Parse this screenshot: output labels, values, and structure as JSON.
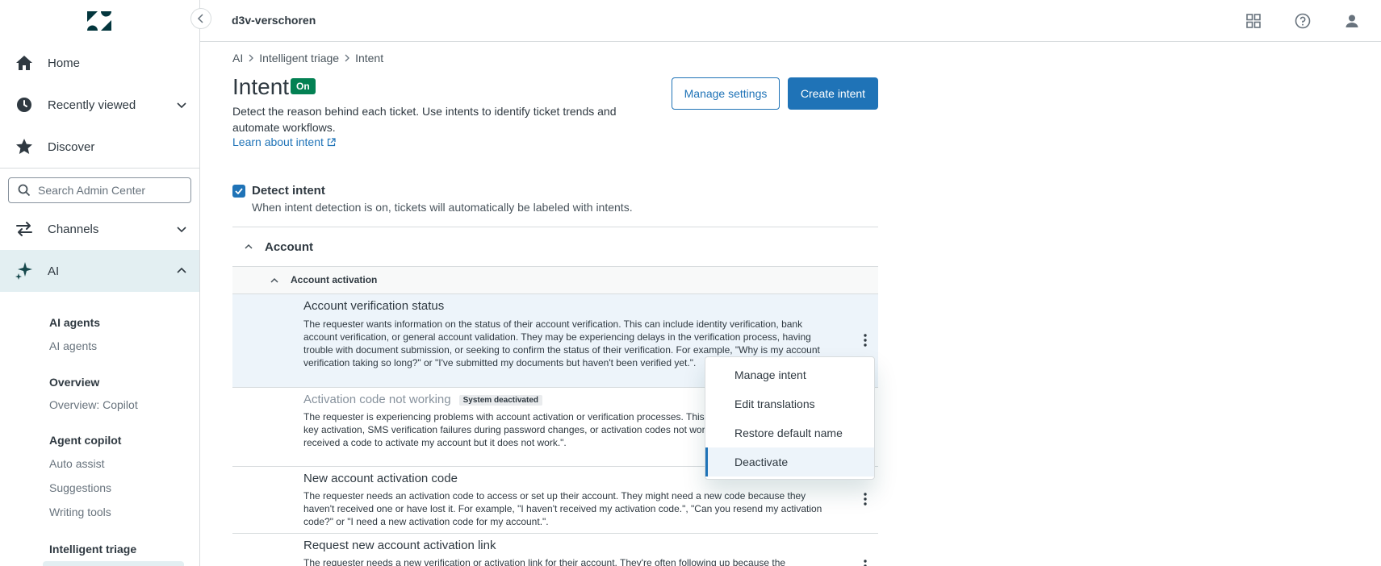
{
  "sidebar": {
    "collapse_label": "Collapse sidebar",
    "nav_top": [
      {
        "label": "Home",
        "icon": "home-icon"
      },
      {
        "label": "Recently viewed",
        "icon": "clock-icon"
      },
      {
        "label": "Discover",
        "icon": "star-icon"
      }
    ],
    "search_placeholder": "Search Admin Center",
    "nav_main": [
      {
        "label": "Channels",
        "icon": "arrows-swap-icon"
      },
      {
        "label": "AI",
        "icon": "sparkle-icon",
        "active": true
      }
    ],
    "sections": [
      {
        "heading": "AI agents",
        "links": [
          "AI agents"
        ]
      },
      {
        "heading": "Overview",
        "links": [
          "Overview: Copilot"
        ]
      },
      {
        "heading": "Agent copilot",
        "links": [
          "Auto assist",
          "Suggestions",
          "Writing tools"
        ]
      },
      {
        "heading": "Intelligent triage",
        "links": []
      }
    ]
  },
  "header": {
    "account": "d3v-verschoren",
    "icons": [
      "products-grid-icon",
      "help-icon",
      "user-icon"
    ]
  },
  "breadcrumb": [
    "AI",
    "Intelligent triage",
    "Intent"
  ],
  "page": {
    "title": "Intent",
    "status_badge": "On",
    "description": "Detect the reason behind each ticket. Use intents to identify ticket trends and automate workflows.",
    "learn_link": "Learn about intent",
    "manage_settings": "Manage settings",
    "create_intent": "Create intent"
  },
  "detect": {
    "label": "Detect intent",
    "hint": "When intent detection is on, tickets will automatically be labeled with intents.",
    "checked": true
  },
  "group": {
    "label": "Account",
    "subgroup": "Account activation"
  },
  "intents": [
    {
      "title": "Account verification status",
      "desc": "The requester wants information on the status of their account verification. This can include identity verification, bank account verification, or general account validation. They may be experiencing delays in the verification process, having trouble with document submission, or seeking to confirm the status of their verification. For example, \"Why is my account verification taking so long?\" or \"I've submitted my documents but haven't been verified yet.\"."
    },
    {
      "title": "Activation code not working",
      "badge": "System deactivated",
      "desc": "The requester is experiencing problems with account activation or verification processes. This can include issues with API key activation, SMS verification failures during password changes, or activation codes not working. For example, \"I've received a code to activate my account but it does not work.\"."
    },
    {
      "title": "New account activation code",
      "desc": "The requester needs an activation code to access or set up their account. They might need a new code because they haven't received one or have lost it. For example, \"I haven't received my activation code.\", \"Can you resend my activation code?\" or \"I need a new activation code for my account.\"."
    },
    {
      "title": "Request new account activation link",
      "desc": "The requester needs a new verification or activation link for their account. They're often following up because the"
    }
  ],
  "menu": {
    "items": [
      "Manage intent",
      "Edit translations",
      "Restore default name",
      "Deactivate"
    ],
    "focused": "Deactivate"
  },
  "colors": {
    "accent": "#1f73b7",
    "badge_on": "#038153",
    "sidebar_active": "#e3eff2",
    "row_highlight": "#edf4fa",
    "logo": "#03363d"
  }
}
